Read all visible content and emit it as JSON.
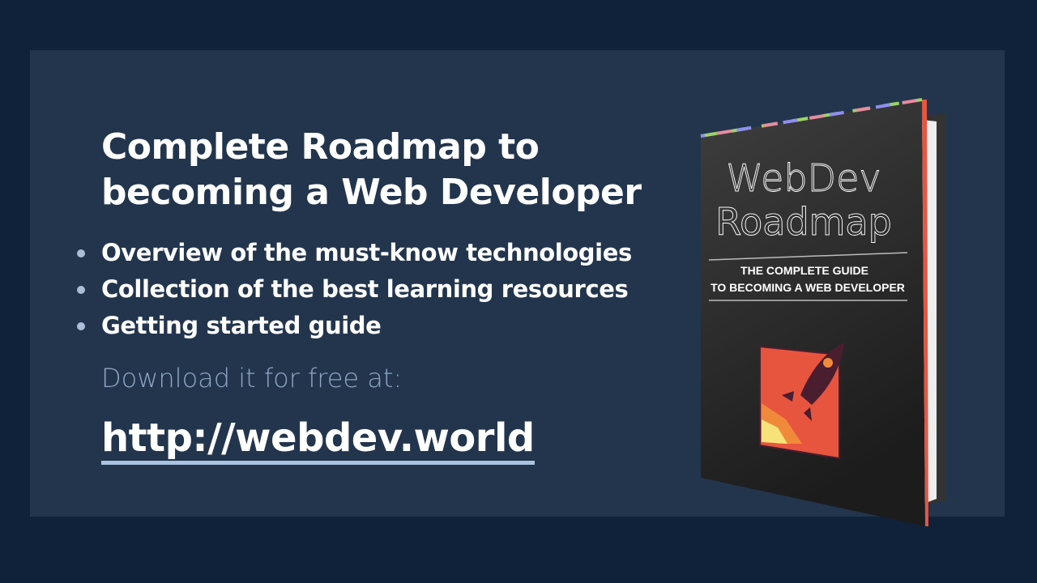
{
  "headline": {
    "line1": "Complete Roadmap to",
    "line2": "becoming a Web Developer"
  },
  "bullets": [
    "Overview of the must-know technologies",
    "Collection of the best learning resources",
    "Getting started guide"
  ],
  "download_label": "Download it for free at:",
  "url": "http://webdev.world",
  "book": {
    "title1": "WebDev",
    "title2": "Roadmap",
    "subtitle1": "THE COMPLETE GUIDE",
    "subtitle2": "TO BECOMING A WEB DEVELOPER"
  },
  "colors": {
    "background": "#10223a",
    "panel": "#22354d",
    "accent": "#e8553f"
  }
}
